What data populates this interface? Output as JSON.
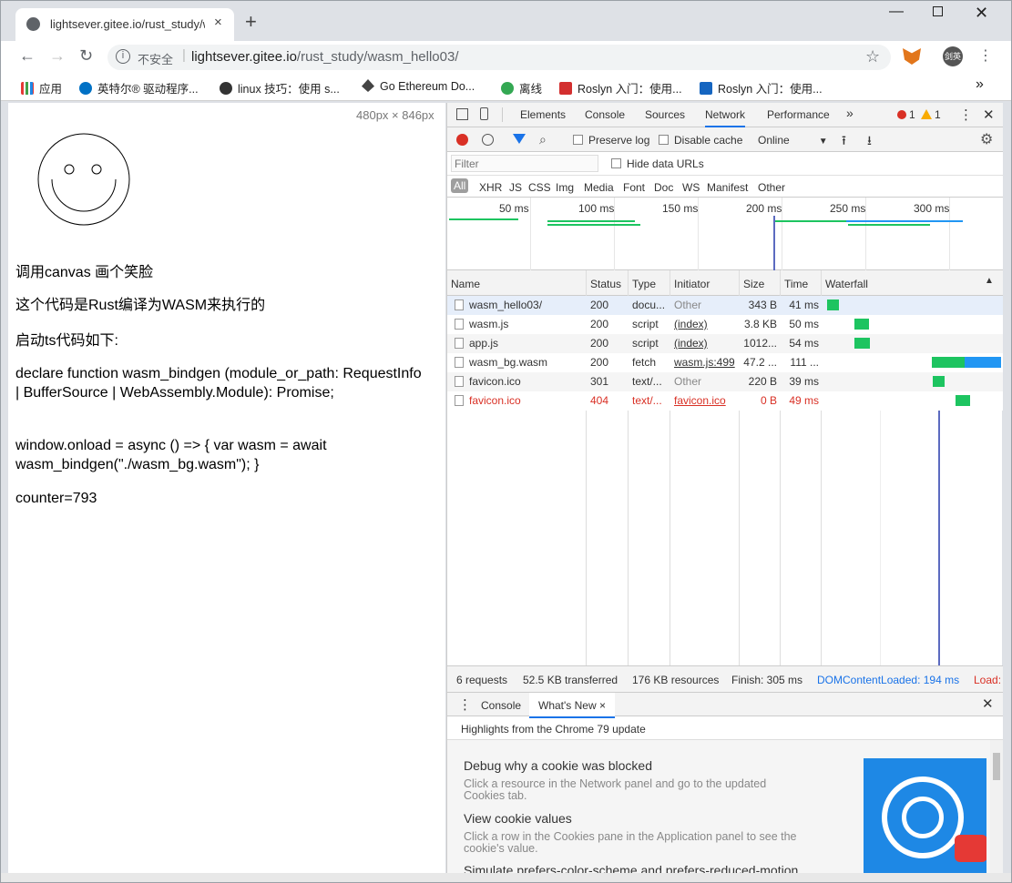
{
  "browser": {
    "tab_title": "lightsever.gitee.io/rust_study/w",
    "tab_close": "×",
    "new_tab": "+",
    "omnibox": {
      "insecure_label": "不安全",
      "url_host": "lightsever.gitee.io",
      "url_path": "/rust_study/wasm_hello03/"
    },
    "profile_label": "剑英",
    "bookmarks": [
      {
        "label": "应用",
        "icon": "apps-grid-icon"
      },
      {
        "label": "英特尔® 驱动程序...",
        "icon": "intel-icon"
      },
      {
        "label": "linux 技巧：使用 s...",
        "icon": "linux-icon"
      },
      {
        "label": "Go Ethereum Do...",
        "icon": "ethereum-icon"
      },
      {
        "label": "离线",
        "icon": "c-circle-icon"
      },
      {
        "label": "Roslyn 入门：使用...",
        "icon": "roslyn-icon"
      },
      {
        "label": "Roslyn 入门：使用...",
        "icon": "windows-icon"
      }
    ],
    "bookmarks_more": "»"
  },
  "page": {
    "dims": "480px × 846px",
    "line1": "调用canvas 画个笑脸",
    "line2": "这个代码是Rust编译为WASM来执行的",
    "line3": "启动ts代码如下:",
    "line4": "declare function wasm_bindgen (module_or_path: RequestInfo | BufferSource | WebAssembly.Module): Promise;",
    "line5": "window.onload = async () => { var wasm = await wasm_bindgen(\"./wasm_bg.wasm\"); }",
    "line6": "counter=793"
  },
  "devtools": {
    "tabs": [
      "Elements",
      "Console",
      "Sources",
      "Network",
      "Performance"
    ],
    "more_tabs": "»",
    "errors": "1",
    "warnings": "1",
    "preserve_log": "Preserve log",
    "disable_cache": "Disable cache",
    "throttle": "Online",
    "filter_placeholder": "Filter",
    "hide_data_urls": "Hide data URLs",
    "type_filters": [
      "All",
      "XHR",
      "JS",
      "CSS",
      "Img",
      "Media",
      "Font",
      "Doc",
      "WS",
      "Manifest",
      "Other"
    ],
    "timeline_ticks": [
      "50 ms",
      "100 ms",
      "150 ms",
      "200 ms",
      "250 ms",
      "300 ms"
    ],
    "columns": [
      "Name",
      "Status",
      "Type",
      "Initiator",
      "Size",
      "Time",
      "Waterfall"
    ],
    "requests": [
      {
        "name": "wasm_hello03/",
        "status": "200",
        "type": "docu...",
        "initiator": "Other",
        "size": "343 B",
        "time": "41 ms",
        "error": false,
        "initiator_link": false,
        "wf_start": 0,
        "wf_dur": 41
      },
      {
        "name": "wasm.js",
        "status": "200",
        "type": "script",
        "initiator": "(index)",
        "size": "3.8 KB",
        "time": "50 ms",
        "error": false,
        "initiator_link": true,
        "wf_start": 50,
        "wf_dur": 50
      },
      {
        "name": "app.js",
        "status": "200",
        "type": "script",
        "initiator": "(index)",
        "size": "1012...",
        "time": "54 ms",
        "error": false,
        "initiator_link": true,
        "wf_start": 50,
        "wf_dur": 54
      },
      {
        "name": "wasm_bg.wasm",
        "status": "200",
        "type": "fetch",
        "initiator": "wasm.js:499",
        "size": "47.2 ...",
        "time": "111 ...",
        "error": false,
        "initiator_link": true,
        "wf_start": 194,
        "wf_dur": 111
      },
      {
        "name": "favicon.ico",
        "status": "301",
        "type": "text/...",
        "initiator": "Other",
        "size": "220 B",
        "time": "39 ms",
        "error": false,
        "initiator_link": false,
        "wf_start": 196,
        "wf_dur": 39
      },
      {
        "name": "favicon.ico",
        "status": "404",
        "type": "text/...",
        "initiator": "favicon.ico",
        "size": "0 B",
        "time": "49 ms",
        "error": true,
        "initiator_link": true,
        "wf_start": 237,
        "wf_dur": 49
      }
    ],
    "summary": {
      "requests": "6 requests",
      "transferred": "52.5 KB transferred",
      "resources": "176 KB resources",
      "finish": "Finish: 305 ms",
      "dcl": "DOMContentLoaded: 194 ms",
      "load": "Load:"
    },
    "drawer": {
      "tabs": [
        "Console",
        "What's New"
      ],
      "close": "×",
      "highlights": "Highlights from the Chrome 79 update",
      "cards": [
        {
          "title": "Debug why a cookie was blocked",
          "desc": "Click a resource in the Network panel and go to the updated Cookies tab."
        },
        {
          "title": "View cookie values",
          "desc": "Click a row in the Cookies pane in the Application panel to see the cookie's value."
        },
        {
          "title": "Simulate prefers-color-scheme and prefers-reduced-motion",
          "desc": ""
        }
      ]
    }
  },
  "colors": {
    "accent": "#1a73e8",
    "waterfall_green": "#1dc460",
    "waterfall_blue": "#2196f3",
    "error_red": "#d93025"
  }
}
